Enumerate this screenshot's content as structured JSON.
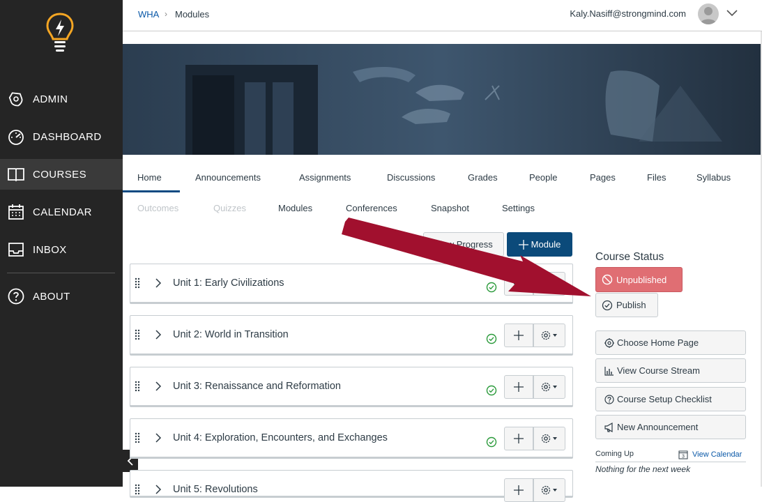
{
  "sidebar": {
    "logo_icon": "lightbulb-logo-icon",
    "items": [
      {
        "label": "ADMIN",
        "icon": "shield-icon"
      },
      {
        "label": "DASHBOARD",
        "icon": "speedometer-icon"
      },
      {
        "label": "COURSES",
        "icon": "book-icon"
      },
      {
        "label": "CALENDAR",
        "icon": "calendar-icon"
      },
      {
        "label": "INBOX",
        "icon": "inbox-icon"
      },
      {
        "label": "ABOUT",
        "icon": "help-icon"
      }
    ],
    "active_item": "COURSES"
  },
  "header": {
    "breadcrumb_root": "WHA",
    "breadcrumb_sep": "›",
    "breadcrumb_current": "Modules",
    "user_email": "Kaly.Nasiff@strongmind.com"
  },
  "tabs_row1": [
    "Home",
    "Announcements",
    "Assignments",
    "Discussions",
    "Grades",
    "People",
    "Pages",
    "Files",
    "Syllabus"
  ],
  "tabs_row2": [
    {
      "label": "Outcomes",
      "disabled": true
    },
    {
      "label": "Quizzes",
      "disabled": true
    },
    {
      "label": "Modules",
      "disabled": false
    },
    {
      "label": "Conferences",
      "disabled": false
    },
    {
      "label": "Snapshot",
      "disabled": false
    },
    {
      "label": "Settings",
      "disabled": false
    }
  ],
  "toolbar": {
    "view_progress": "View Progress",
    "add_module": "Module"
  },
  "modules": [
    {
      "title": "Unit 1: Early Civilizations"
    },
    {
      "title": "Unit 2: World in Transition"
    },
    {
      "title": "Unit 3: Renaissance and Reformation"
    },
    {
      "title": "Unit 4: Exploration, Encounters, and Exchanges"
    },
    {
      "title": "Unit 5: Revolutions"
    }
  ],
  "course_status": {
    "title": "Course Status",
    "unpublished": "Unpublished",
    "publish": "Publish"
  },
  "side_actions": [
    {
      "label": "Choose Home Page",
      "icon": "target-icon"
    },
    {
      "label": "View Course Stream",
      "icon": "chart-icon"
    },
    {
      "label": "Course Setup Checklist",
      "icon": "question-icon"
    },
    {
      "label": "New Announcement",
      "icon": "megaphone-icon"
    }
  ],
  "coming_up": {
    "label": "Coming Up",
    "view_calendar": "View Calendar",
    "calendar_day": "3",
    "empty": "Nothing for the next week"
  },
  "colors": {
    "sidebar_bg": "#252525",
    "brand_blue": "#0b4a7a",
    "link": "#0b59a8",
    "unpublished": "#e06e73",
    "published_green": "#2a9a3a",
    "arrow": "#a1102e",
    "logo": "#f5a623"
  }
}
